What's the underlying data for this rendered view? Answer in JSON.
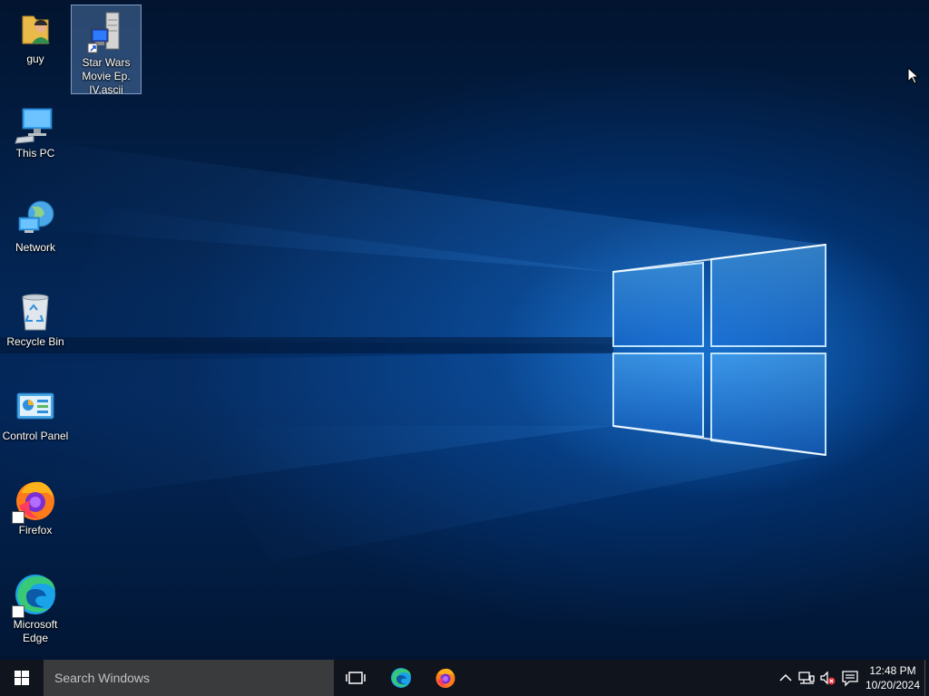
{
  "desktop": {
    "icons": [
      {
        "label": "guy",
        "icon": "user-folder-icon"
      },
      {
        "label": "Star Wars Movie Ep. IV.ascii",
        "icon": "remote-desktop-file-icon",
        "selected": true
      },
      {
        "label": "This PC",
        "icon": "computer-icon"
      },
      {
        "label": "Network",
        "icon": "network-icon"
      },
      {
        "label": "Recycle Bin",
        "icon": "recycle-bin-icon"
      },
      {
        "label": "Control Panel",
        "icon": "control-panel-icon"
      },
      {
        "label": "Firefox",
        "icon": "firefox-icon",
        "shortcut": true
      },
      {
        "label": "Microsoft Edge",
        "icon": "edge-icon",
        "shortcut": true
      }
    ]
  },
  "taskbar": {
    "search_placeholder": "Search Windows",
    "pinned": [
      "task-view-icon",
      "edge-icon",
      "firefox-icon"
    ],
    "tray": [
      "chevron-up-icon",
      "network-icon",
      "volume-muted-icon",
      "notifications-icon"
    ],
    "time": "12:48 PM",
    "date": "10/20/2024"
  },
  "colors": {
    "wallpaper": "#03275a",
    "glow": "#2f9bff",
    "taskbar": "#10141c",
    "search": "#3a3b3d",
    "selection": "#78aae6"
  }
}
